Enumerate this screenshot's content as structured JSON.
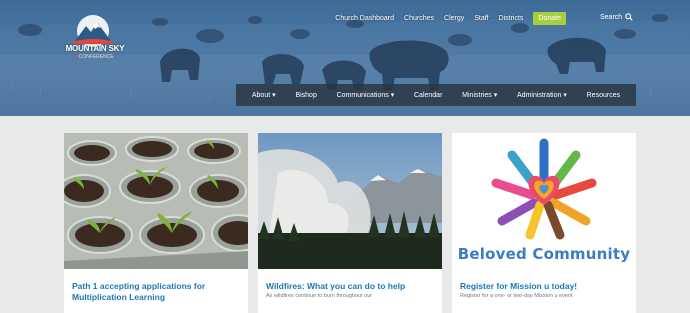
{
  "logo": {
    "title": "MOUNTAIN SKY",
    "subtitle": "CONFERENCE"
  },
  "top_links": [
    {
      "label": "Church Dashboard"
    },
    {
      "label": "Churches"
    },
    {
      "label": "Clergy"
    },
    {
      "label": "Staff"
    },
    {
      "label": "Districts"
    }
  ],
  "donate_label": "Donate",
  "search_label": "Search",
  "nav": {
    "about": "About",
    "bishop": "Bishop",
    "communications": "Communications",
    "calendar": "Calendar",
    "ministries": "Ministries",
    "administration": "Administration",
    "resources": "Resources"
  },
  "cards": [
    {
      "title": "Path 1 accepting applications for Multiplication Learning",
      "desc": ""
    },
    {
      "title": "Wildfires: What you can do to help",
      "desc": "As wildfires continue to burn throughout our"
    },
    {
      "title": "Register for Mission u today!",
      "desc": "Register for a one- or two-day Mission u event",
      "image_text": "Beloved Community"
    }
  ],
  "colors": {
    "accent_link": "#1e78b4",
    "donate": "#a6cf3f",
    "nav_bg": "#28343f",
    "page_bg": "#e9e9e9"
  }
}
